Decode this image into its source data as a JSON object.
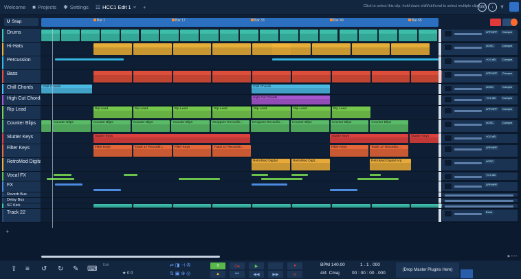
{
  "topbar": {
    "tabs": [
      {
        "label": "Welcome",
        "icon": "home-icon"
      },
      {
        "label": "Projects",
        "icon": "folder-icon"
      },
      {
        "label": "Settings",
        "icon": "gear-icon"
      },
      {
        "label": "HCC1 Edit 1",
        "icon": "mixer-icon"
      }
    ],
    "add_tab": "+",
    "hint": "Click to select this clip, hold down shift/ctrl/cmd to select multiple clips",
    "cpu": "100"
  },
  "timeline": {
    "snap_label": "Snap",
    "markers": [
      "Bar 1",
      "Bar 17",
      "Bar 33",
      "Bar 49",
      "Bar 65"
    ]
  },
  "tracks": [
    {
      "name": "Drums",
      "color": "#3fc7b1"
    },
    {
      "name": "Hi-Hats",
      "color": "#f0b43a"
    },
    {
      "name": "Percussion",
      "color": "#36b8e0"
    },
    {
      "name": "Bass",
      "color": "#e8513b"
    },
    {
      "name": "Chill Chords",
      "color": "#4fc1ec"
    },
    {
      "name": "High Cut Chords",
      "color": "#b05bd6"
    },
    {
      "name": "Rip Lead",
      "color": "#7bd24e"
    },
    {
      "name": "Counter Blips",
      "color": "#5ec46b"
    },
    {
      "name": "Stutter Keys",
      "color": "#e8433f"
    },
    {
      "name": "Filter Keys",
      "color": "#f06a3a"
    },
    {
      "name": "RetroMod Digital",
      "color": "#f3b23b"
    },
    {
      "name": "Vocal FX",
      "color": "#6cc34b"
    },
    {
      "name": "FX",
      "color": "#4d8be0"
    },
    {
      "name": "Reverb Bus",
      "color": "#2a4d78"
    },
    {
      "name": "Delay Bus",
      "color": "#2a4d78"
    },
    {
      "name": "SC Kick",
      "color": "#3fc7b1"
    },
    {
      "name": "Track 22",
      "color": "#2a4d78"
    }
  ],
  "clip_labels": {
    "chill": "Chill Chords",
    "highcut": "High Cut Chords",
    "rip": [
      "Rip Lead",
      "Rip Lead",
      "Rip Lead",
      "Rip Lead",
      "Rip Lead",
      "Rip Lead",
      "Rip Lead"
    ],
    "counter": [
      "Counter Blips",
      "Counter Blips",
      "Counter Blips",
      "Counter Blips",
      "Droppers Recordin...",
      "Droppers Recordin...",
      "Counter Blips",
      "Counter Blips",
      "Counter Blips"
    ],
    "stutter": "Stutter Keys",
    "filter": [
      "Filter Keys",
      "Track 17 Recordin...",
      "Filter Keys",
      "Track 17 Recordin...",
      "Filter Keys",
      "Track 17 Recordin..."
    ],
    "retro": [
      "RetroMod Digital",
      "RetroMod Digit...",
      "RetroMod Digital Arp"
    ]
  },
  "plugins": {
    "eq": "LPF/HPF",
    "comp": "Compressor",
    "acdc": "4OSC",
    "reverb": "Echo",
    "vol": "+0.0 dB"
  },
  "transport": {
    "bpm": "BPM 140.00",
    "time_sig": "4/4",
    "key": "Cmaj",
    "position": "1 . 1 . 000",
    "time": "00 : 00 : 00 . 000",
    "edit": "Edit",
    "rating": "★ 0 0"
  },
  "master_drop": "(Drop Master Plugins Here)"
}
